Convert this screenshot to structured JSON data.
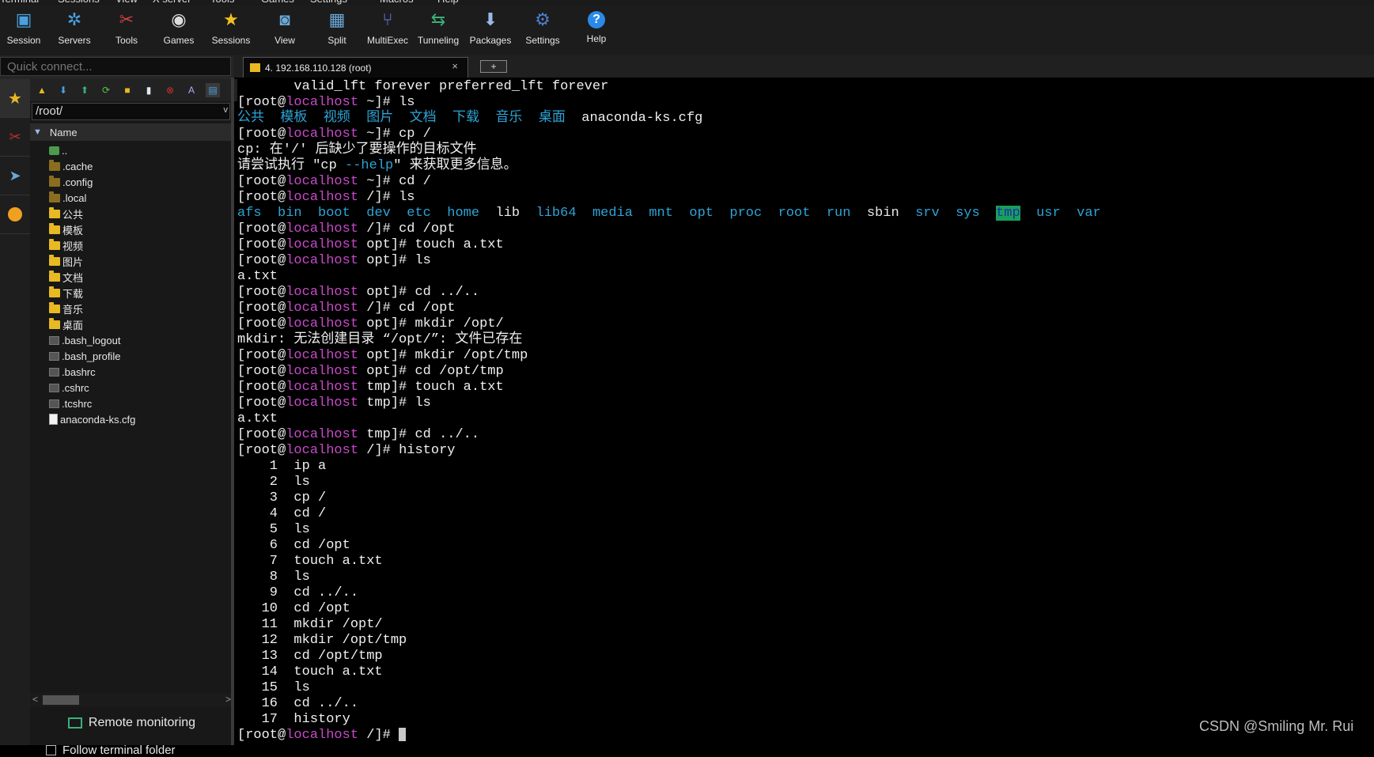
{
  "menubar": [
    "Terminal",
    "Sessions",
    "View",
    "X server",
    "Tools",
    "Games",
    "Settings",
    "Macros",
    "Help"
  ],
  "toolbar": [
    {
      "label": "Session",
      "icon": "session-icon"
    },
    {
      "label": "Servers",
      "icon": "servers-icon"
    },
    {
      "label": "Tools",
      "icon": "tools-icon"
    },
    {
      "label": "Games",
      "icon": "gamepad-icon"
    },
    {
      "label": "Sessions",
      "icon": "star-icon"
    },
    {
      "label": "View",
      "icon": "view-icon"
    },
    {
      "label": "Split",
      "icon": "split-icon"
    },
    {
      "label": "MultiExec",
      "icon": "multiexec-icon"
    },
    {
      "label": "Tunneling",
      "icon": "tunneling-icon"
    },
    {
      "label": "Packages",
      "icon": "packages-icon"
    },
    {
      "label": "Settings",
      "icon": "settings-icon"
    },
    {
      "label": "Help",
      "icon": "help-icon"
    }
  ],
  "sidebar": {
    "quick_connect_placeholder": "Quick connect...",
    "path": "/root/",
    "tree_header": "Name",
    "files": [
      {
        "name": "..",
        "type": "up"
      },
      {
        "name": ".cache",
        "type": "folder-dark"
      },
      {
        "name": ".config",
        "type": "folder-dark"
      },
      {
        "name": ".local",
        "type": "folder-dark"
      },
      {
        "name": "公共",
        "type": "folder"
      },
      {
        "name": "模板",
        "type": "folder"
      },
      {
        "name": "视频",
        "type": "folder"
      },
      {
        "name": "图片",
        "type": "folder"
      },
      {
        "name": "文档",
        "type": "folder"
      },
      {
        "name": "下载",
        "type": "folder"
      },
      {
        "name": "音乐",
        "type": "folder"
      },
      {
        "name": "桌面",
        "type": "folder"
      },
      {
        "name": ".bash_logout",
        "type": "file"
      },
      {
        "name": ".bash_profile",
        "type": "file"
      },
      {
        "name": ".bashrc",
        "type": "file"
      },
      {
        "name": ".cshrc",
        "type": "file"
      },
      {
        "name": ".tcshrc",
        "type": "file"
      },
      {
        "name": "anaconda-ks.cfg",
        "type": "cfg"
      }
    ],
    "remote_monitoring": "Remote monitoring",
    "follow_terminal": "Follow terminal folder"
  },
  "tab": {
    "title": "4. 192.168.110.128 (root)",
    "close": "×",
    "new": "+"
  },
  "terminal": {
    "user": "[root@",
    "host": "localhost",
    "lines": [
      {
        "t": "out",
        "text": "       valid_lft forever preferred_lft forever"
      },
      {
        "t": "cmd",
        "dir": "~",
        "cmd": "ls"
      },
      {
        "t": "lsroot",
        "items": [
          "公共",
          "模板",
          "视频",
          "图片",
          "文档",
          "下载",
          "音乐",
          "桌面"
        ],
        "file": "anaconda-ks.cfg"
      },
      {
        "t": "cmd",
        "dir": "~",
        "cmd": "cp /"
      },
      {
        "t": "out",
        "text": "cp: 在'/' 后缺少了要操作的目标文件"
      },
      {
        "t": "help",
        "before": "请尝试执行 \"cp ",
        "flag": "--help",
        "after": "\" 来获取更多信息。"
      },
      {
        "t": "cmd",
        "dir": "~",
        "cmd": "cd /"
      },
      {
        "t": "cmd",
        "dir": "/",
        "cmd": "ls"
      },
      {
        "t": "lsslash",
        "items": [
          "afs",
          "bin",
          "boot",
          "dev",
          "etc",
          "home",
          "lib",
          "lib64",
          "media",
          "mnt",
          "opt",
          "proc",
          "root",
          "run",
          "sbin",
          "srv",
          "sys",
          "tmp",
          "usr",
          "var"
        ]
      },
      {
        "t": "cmd",
        "dir": "/",
        "cmd": "cd /opt"
      },
      {
        "t": "cmd",
        "dir": "opt",
        "cmd": "touch a.txt"
      },
      {
        "t": "cmd",
        "dir": "opt",
        "cmd": "ls"
      },
      {
        "t": "out",
        "text": "a.txt"
      },
      {
        "t": "cmd",
        "dir": "opt",
        "cmd": "cd ../.."
      },
      {
        "t": "cmd",
        "dir": "/",
        "cmd": "cd /opt"
      },
      {
        "t": "cmd",
        "dir": "opt",
        "cmd": "mkdir /opt/"
      },
      {
        "t": "out",
        "text": "mkdir: 无法创建目录 “/opt/”: 文件已存在"
      },
      {
        "t": "cmd",
        "dir": "opt",
        "cmd": "mkdir /opt/tmp"
      },
      {
        "t": "cmd",
        "dir": "opt",
        "cmd": "cd /opt/tmp"
      },
      {
        "t": "cmd",
        "dir": "tmp",
        "cmd": "touch a.txt"
      },
      {
        "t": "cmd",
        "dir": "tmp",
        "cmd": "ls"
      },
      {
        "t": "out",
        "text": "a.txt"
      },
      {
        "t": "cmd",
        "dir": "tmp",
        "cmd": "cd ../.."
      },
      {
        "t": "cmd",
        "dir": "/",
        "cmd": "history"
      },
      {
        "t": "out",
        "text": "    1  ip a"
      },
      {
        "t": "out",
        "text": "    2  ls"
      },
      {
        "t": "out",
        "text": "    3  cp /"
      },
      {
        "t": "out",
        "text": "    4  cd /"
      },
      {
        "t": "out",
        "text": "    5  ls"
      },
      {
        "t": "out",
        "text": "    6  cd /opt"
      },
      {
        "t": "out",
        "text": "    7  touch a.txt"
      },
      {
        "t": "out",
        "text": "    8  ls"
      },
      {
        "t": "out",
        "text": "    9  cd ../.."
      },
      {
        "t": "out",
        "text": "   10  cd /opt"
      },
      {
        "t": "out",
        "text": "   11  mkdir /opt/"
      },
      {
        "t": "out",
        "text": "   12  mkdir /opt/tmp"
      },
      {
        "t": "out",
        "text": "   13  cd /opt/tmp"
      },
      {
        "t": "out",
        "text": "   14  touch a.txt"
      },
      {
        "t": "out",
        "text": "   15  ls"
      },
      {
        "t": "out",
        "text": "   16  cd ../.."
      },
      {
        "t": "out",
        "text": "   17  history"
      },
      {
        "t": "prompt",
        "dir": "/"
      }
    ]
  },
  "watermark": "CSDN @Smiling Mr. Rui",
  "colors": {
    "host": "#c84ac8",
    "dir": "#2ea3d6",
    "tmp_bg": "#17a05d"
  }
}
